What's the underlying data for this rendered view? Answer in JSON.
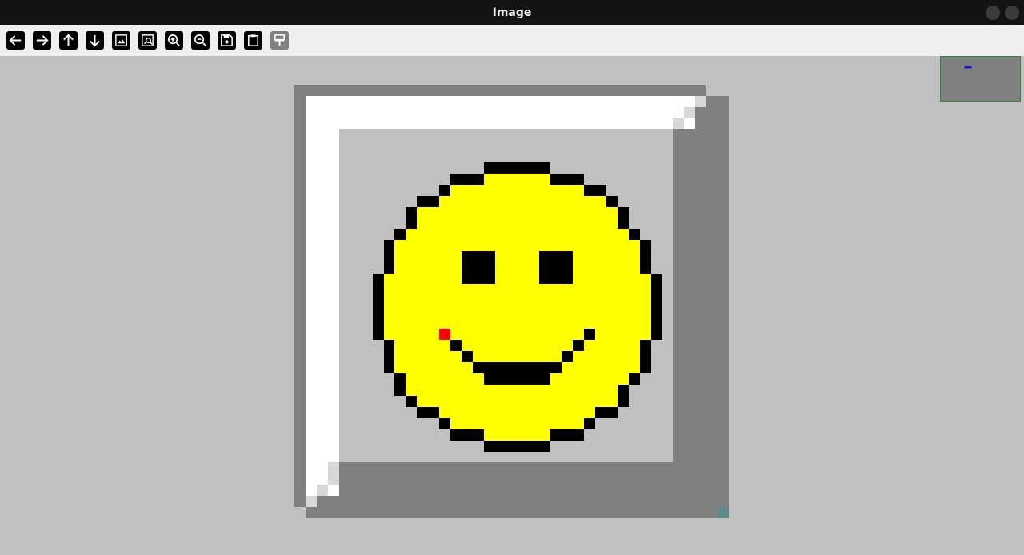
{
  "window": {
    "title": "Image"
  },
  "toolbar": {
    "buttons": [
      {
        "name": "back-button",
        "icon": "arrow-left-icon",
        "enabled": true
      },
      {
        "name": "forward-button",
        "icon": "arrow-right-icon",
        "enabled": true
      },
      {
        "name": "up-button",
        "icon": "arrow-up-icon",
        "enabled": true
      },
      {
        "name": "down-button",
        "icon": "arrow-down-icon",
        "enabled": true
      },
      {
        "name": "fit-image-button",
        "icon": "image-icon",
        "enabled": true
      },
      {
        "name": "image-search-button",
        "icon": "image-search-icon",
        "enabled": true
      },
      {
        "name": "zoom-in-button",
        "icon": "zoom-in-icon",
        "enabled": true
      },
      {
        "name": "zoom-out-button",
        "icon": "zoom-out-icon",
        "enabled": true
      },
      {
        "name": "save-button",
        "icon": "floppy-disk-icon",
        "enabled": true
      },
      {
        "name": "clipboard-button",
        "icon": "clipboard-icon",
        "enabled": true
      },
      {
        "name": "paint-button",
        "icon": "paint-roller-icon",
        "enabled": false
      }
    ]
  },
  "image": {
    "description_colors": {
      "face": "#ffff00",
      "outline": "#000000",
      "highlight": "#ffffff",
      "shadow": "#808080",
      "background": "#c0c0c0",
      "marker": "#ff0000",
      "corner": "#5f8a8b"
    }
  },
  "navigator": {
    "frame_color": "#2e8b2e",
    "viewport_color": "#1a1aa0"
  }
}
